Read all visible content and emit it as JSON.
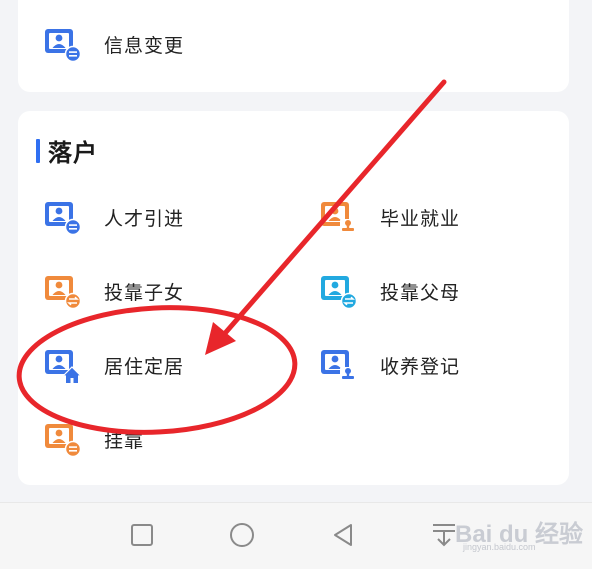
{
  "top_item": {
    "label": "信息变更",
    "icon": "person-card-list-icon",
    "color": "#3b73e6"
  },
  "section": {
    "title": "落户",
    "accent": "#2f6ff2"
  },
  "items": [
    {
      "label": "人才引进",
      "icon": "person-card-list-icon",
      "color": "#3b73e6"
    },
    {
      "label": "毕业就业",
      "icon": "person-card-stamp-icon",
      "color": "#f08a3c"
    },
    {
      "label": "投靠子女",
      "icon": "person-card-exchange-icon",
      "color": "#f08a3c"
    },
    {
      "label": "投靠父母",
      "icon": "person-card-exchange-icon",
      "color": "#22a9e0"
    },
    {
      "label": "居住定居",
      "icon": "person-card-home-icon",
      "color": "#3b73e6"
    },
    {
      "label": "收养登记",
      "icon": "person-card-stamp-icon",
      "color": "#3b73e6"
    },
    {
      "label": "挂靠",
      "icon": "person-card-list-icon",
      "color": "#f08a3c"
    }
  ],
  "nav_bar": {
    "buttons": [
      "square-recents-icon",
      "circle-home-icon",
      "triangle-back-icon",
      "download-menu-icon"
    ]
  },
  "annotation": {
    "color": "#e8262b"
  },
  "watermark": {
    "logo": "Bai du 经验",
    "url": "jingyan.baidu.com"
  }
}
